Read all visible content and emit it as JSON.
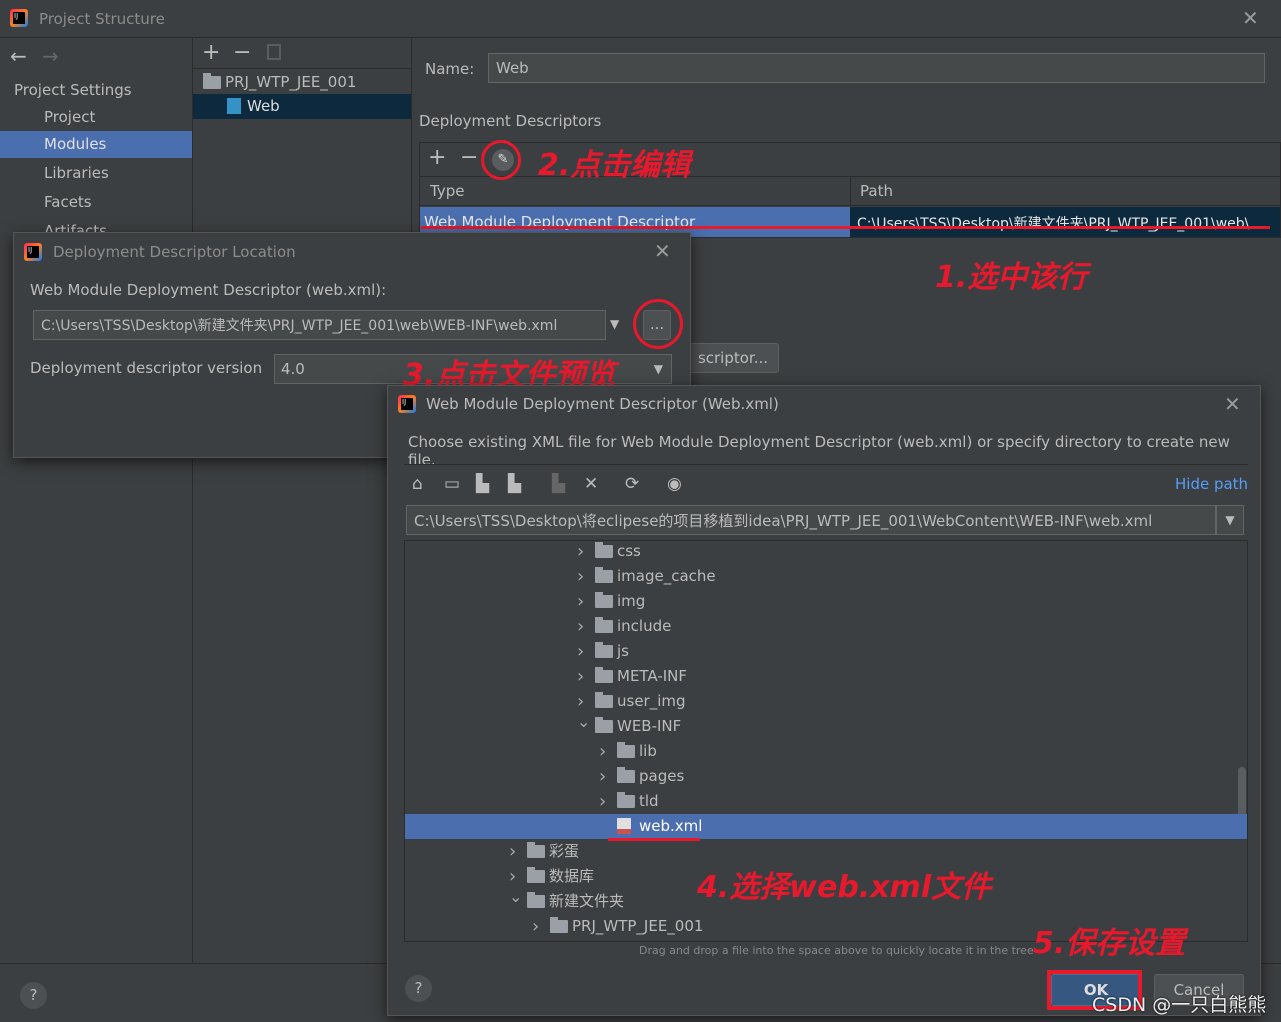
{
  "window": {
    "title": "Project Structure"
  },
  "sidebar": {
    "section": "Project Settings",
    "items": [
      {
        "label": "Project"
      },
      {
        "label": "Modules",
        "selected": true
      },
      {
        "label": "Libraries"
      },
      {
        "label": "Facets"
      },
      {
        "label": "Artifacts"
      }
    ]
  },
  "modules_tree": {
    "items": [
      {
        "label": "PRJ_WTP_JEE_001"
      },
      {
        "label": "Web",
        "selected": true
      }
    ]
  },
  "facet": {
    "name_label": "Name:",
    "name_value": "Web",
    "descriptors_title": "Deployment Descriptors",
    "columns": [
      "Type",
      "Path"
    ],
    "row": {
      "type": "Web Module Deployment Descriptor",
      "path": "C:\\Users\\TSS\\Desktop\\新建文件夹\\PRJ_WTP_JEE_001\\web\\"
    },
    "add_descriptor_label": "scriptor..."
  },
  "location_dialog": {
    "title": "Deployment Descriptor Location",
    "field_label": "Web Module Deployment Descriptor (web.xml):",
    "path": "C:\\Users\\TSS\\Desktop\\新建文件夹\\PRJ_WTP_JEE_001\\web\\WEB-INF\\web.xml",
    "browse_label": "...",
    "version_label": "Deployment descriptor version",
    "version_value": "4.0"
  },
  "chooser": {
    "title": "Web Module Deployment Descriptor (Web.xml)",
    "description": "Choose existing XML file for Web Module Deployment Descriptor (web.xml) or specify directory to create new file.",
    "hide_path": "Hide path",
    "path": "C:\\Users\\TSS\\Desktop\\将eclipese的项目移植到idea\\PRJ_WTP_JEE_001\\WebContent\\WEB-INF\\web.xml",
    "hint": "Drag and drop a file into the space above to quickly locate it in the tree",
    "ok": "OK",
    "cancel": "Cancel",
    "tree": [
      {
        "label": "css",
        "level": 2,
        "expanded": false
      },
      {
        "label": "image_cache",
        "level": 2,
        "expanded": false
      },
      {
        "label": "img",
        "level": 2,
        "expanded": false
      },
      {
        "label": "include",
        "level": 2,
        "expanded": false
      },
      {
        "label": "js",
        "level": 2,
        "expanded": false
      },
      {
        "label": "META-INF",
        "level": 2,
        "expanded": false
      },
      {
        "label": "user_img",
        "level": 2,
        "expanded": false
      },
      {
        "label": "WEB-INF",
        "level": 2,
        "expanded": true
      },
      {
        "label": "lib",
        "level": 3,
        "expanded": false
      },
      {
        "label": "pages",
        "level": 3,
        "expanded": false
      },
      {
        "label": "tld",
        "level": 3,
        "expanded": false
      },
      {
        "label": "web.xml",
        "level": 3,
        "file": true,
        "selected": true
      },
      {
        "label": "彩蛋",
        "level": 0,
        "expanded": false
      },
      {
        "label": "数据库",
        "level": 0,
        "expanded": false
      },
      {
        "label": "新建文件夹",
        "level": 0,
        "expanded": true
      },
      {
        "label": "PRJ_WTP_JEE_001",
        "level": 1,
        "expanded": false
      }
    ]
  },
  "annotations": {
    "step1": "1.选中该行",
    "step2": "2.点击编辑",
    "step3": "3.点击文件预览",
    "step4": "4.选择web.xml文件",
    "step5": "5.保存设置"
  },
  "watermark": "CSDN @一只白熊熊",
  "help": "?",
  "colors": {
    "selection": "#4b6eaf",
    "annotation": "#e8192c",
    "link": "#589df6",
    "background": "#3c3f41"
  }
}
